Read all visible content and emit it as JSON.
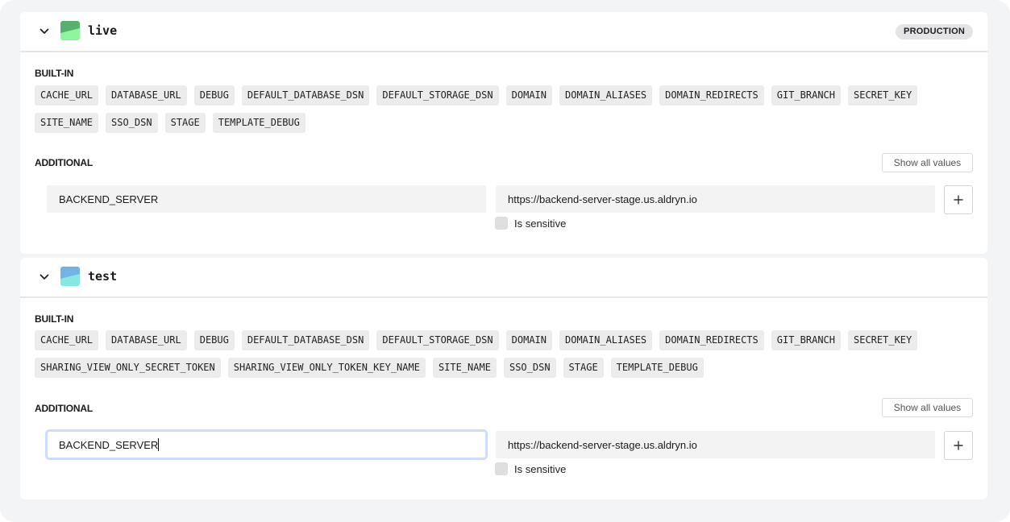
{
  "environments": [
    {
      "name": "live",
      "badge": "PRODUCTION",
      "swatch_colors": {
        "top": "#58b06e",
        "bottom": "#8ef59a"
      },
      "builtin_label": "BUILT-IN",
      "builtin": [
        "CACHE_URL",
        "DATABASE_URL",
        "DEBUG",
        "DEFAULT_DATABASE_DSN",
        "DEFAULT_STORAGE_DSN",
        "DOMAIN",
        "DOMAIN_ALIASES",
        "DOMAIN_REDIRECTS",
        "GIT_BRANCH",
        "SECRET_KEY",
        "SITE_NAME",
        "SSO_DSN",
        "STAGE",
        "TEMPLATE_DEBUG"
      ],
      "additional_label": "ADDITIONAL",
      "show_all_label": "Show all values",
      "variable": {
        "key": "BACKEND_SERVER",
        "value": "https://backend-server-stage.us.aldryn.io",
        "sensitive_label": "Is sensitive",
        "sensitive": false,
        "focused": false
      }
    },
    {
      "name": "test",
      "badge": "",
      "swatch_colors": {
        "top": "#72b4e6",
        "bottom": "#87e8df"
      },
      "builtin_label": "BUILT-IN",
      "builtin": [
        "CACHE_URL",
        "DATABASE_URL",
        "DEBUG",
        "DEFAULT_DATABASE_DSN",
        "DEFAULT_STORAGE_DSN",
        "DOMAIN",
        "DOMAIN_ALIASES",
        "DOMAIN_REDIRECTS",
        "GIT_BRANCH",
        "SECRET_KEY",
        "SHARING_VIEW_ONLY_SECRET_TOKEN",
        "SHARING_VIEW_ONLY_TOKEN_KEY_NAME",
        "SITE_NAME",
        "SSO_DSN",
        "STAGE",
        "TEMPLATE_DEBUG"
      ],
      "additional_label": "ADDITIONAL",
      "show_all_label": "Show all values",
      "variable": {
        "key": "BACKEND_SERVER",
        "value": "https://backend-server-stage.us.aldryn.io",
        "sensitive_label": "Is sensitive",
        "sensitive": false,
        "focused": true
      }
    }
  ],
  "icons": {
    "collapse": "chevron-down-icon",
    "add": "plus-icon"
  },
  "colors": {
    "focus_ring": "#cfdcfb",
    "chip_bg": "#ececec",
    "badge_bg": "#e4e4e6"
  }
}
